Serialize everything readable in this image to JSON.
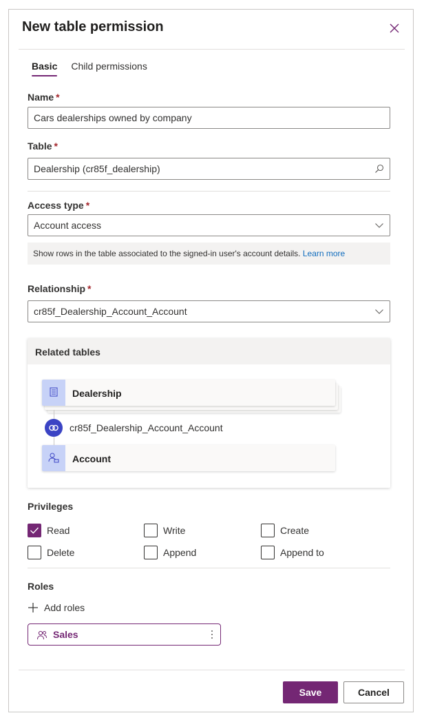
{
  "dialog": {
    "title": "New table permission"
  },
  "tabs": [
    {
      "label": "Basic",
      "active": true
    },
    {
      "label": "Child permissions",
      "active": false
    }
  ],
  "fields": {
    "name": {
      "label": "Name",
      "required_mark": "*",
      "value": "Cars dealerships owned by company"
    },
    "table": {
      "label": "Table",
      "required_mark": "*",
      "value": "Dealership (cr85f_dealership)",
      "icon": "search-icon"
    },
    "access_type": {
      "label": "Access type",
      "required_mark": "*",
      "value": "Account access",
      "icon": "chevron-down-icon"
    },
    "access_info": {
      "text": "Show rows in the table associated to the signed-in user's account details.",
      "link": "Learn more"
    },
    "relationship": {
      "label": "Relationship",
      "required_mark": "*",
      "value": "cr85f_Dealership_Account_Account",
      "icon": "chevron-down-icon"
    }
  },
  "related_tables": {
    "heading": "Related tables",
    "top_table": {
      "label": "Dealership",
      "icon": "table-icon"
    },
    "relationship": {
      "label": "cr85f_Dealership_Account_Account",
      "icon": "link-icon"
    },
    "bottom_table": {
      "label": "Account",
      "icon": "account-icon"
    }
  },
  "privileges": {
    "heading": "Privileges",
    "items": [
      {
        "label": "Read",
        "checked": true
      },
      {
        "label": "Write",
        "checked": false
      },
      {
        "label": "Create",
        "checked": false
      },
      {
        "label": "Delete",
        "checked": false
      },
      {
        "label": "Append",
        "checked": false
      },
      {
        "label": "Append to",
        "checked": false
      }
    ]
  },
  "roles": {
    "heading": "Roles",
    "add_label": "Add roles",
    "items": [
      {
        "label": "Sales",
        "icon": "people-icon"
      }
    ]
  },
  "footer": {
    "save_label": "Save",
    "cancel_label": "Cancel"
  },
  "colors": {
    "accent": "#742774",
    "required": "#a4262c",
    "link": "#0f6cbd",
    "relation_circle": "#3b44c4",
    "table_icon_bg": "#c7d2f7"
  }
}
